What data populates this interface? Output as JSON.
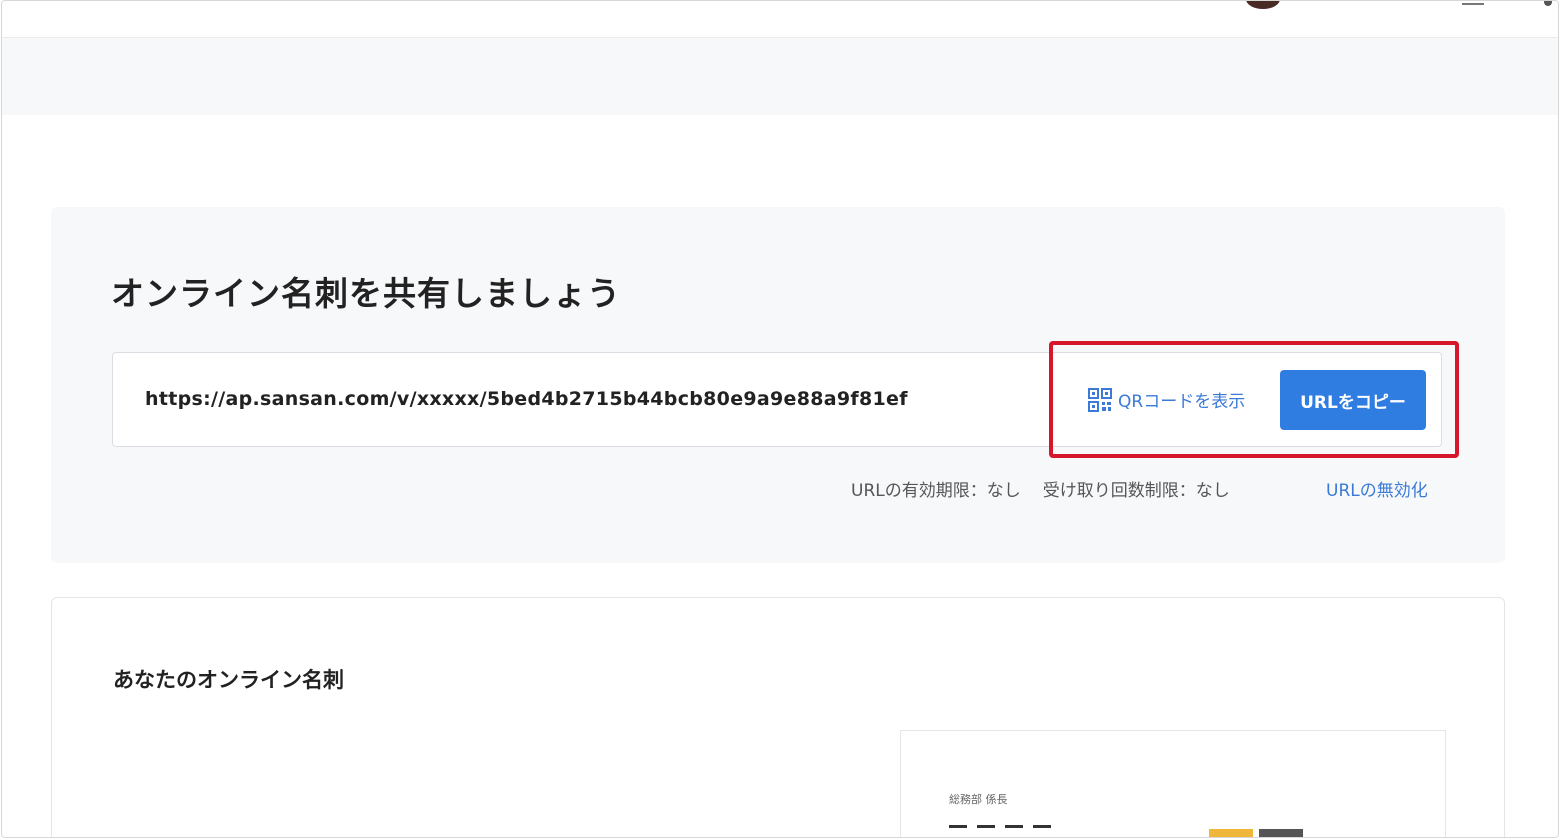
{
  "share": {
    "title": "オンライン名刺を共有しましょう",
    "url": "https://ap.sansan.com/v/xxxxx/5bed4b2715b44bcb80e9a9e88a9f81ef",
    "qr_label": "QRコードを表示",
    "copy_label": "URLをコピー",
    "expiry": "URLの有効期限：なし",
    "receive_limit": "受け取り回数制限：なし",
    "invalidate_label": "URLの無効化"
  },
  "card_section": {
    "title": "あなたのオンライン名刺",
    "department": "総務部 係長"
  },
  "colors": {
    "primary": "#2f7de1",
    "link": "#3b7ad6",
    "highlight": "#d5162b",
    "tag_yellow": "#f0b63a"
  },
  "icons": {
    "qr": "qr-code-icon"
  }
}
